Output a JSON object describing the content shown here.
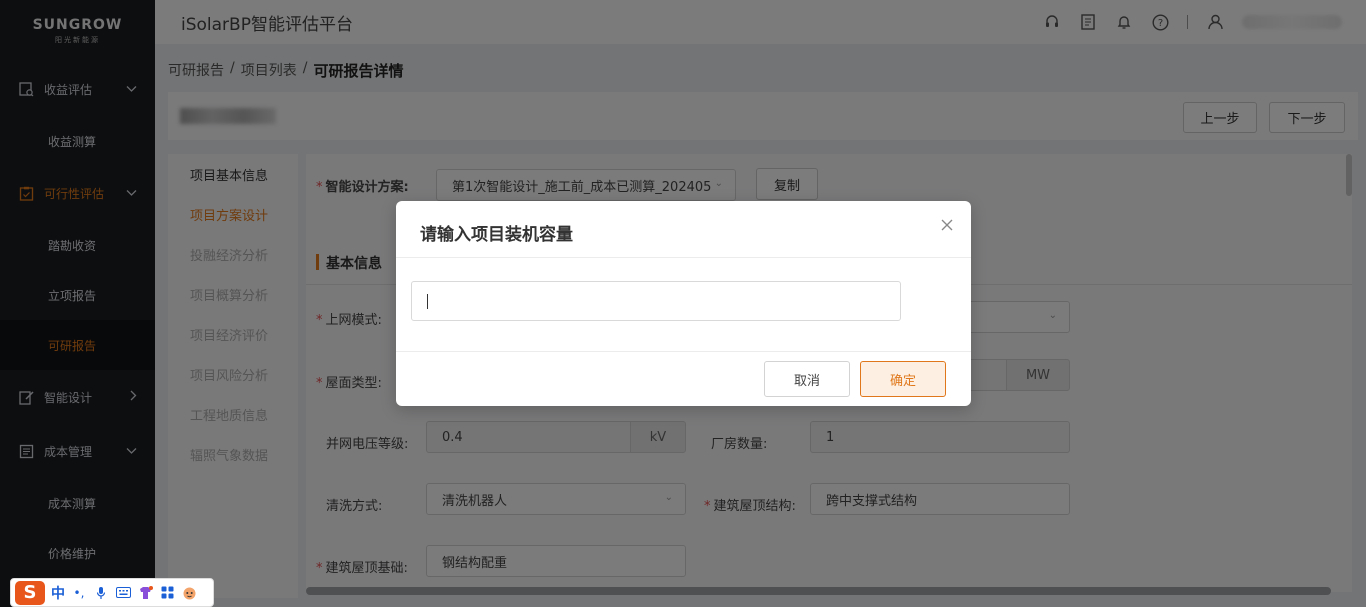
{
  "sidebar": {
    "logo": {
      "brand": "SUNGROW",
      "sub": "阳光新能源"
    },
    "groups": [
      {
        "label": "收益评估",
        "icon": "chart-search-icon",
        "items": [
          "收益测算"
        ]
      },
      {
        "label": "可行性评估",
        "icon": "clipboard-icon",
        "items": [
          "踏勘收资",
          "立项报告",
          "可研报告"
        ]
      },
      {
        "label": "智能设计",
        "icon": "edit-icon"
      },
      {
        "label": "成本管理",
        "icon": "ledger-icon",
        "items": [
          "成本测算",
          "价格维护"
        ]
      }
    ],
    "active_item": "可研报告"
  },
  "header": {
    "title": "iSolarBP智能评估平台"
  },
  "breadcrumb": {
    "items": [
      "可研报告",
      "项目列表"
    ],
    "current": "可研报告详情",
    "sep": "/"
  },
  "toolbar": {
    "prev_label": "上一步",
    "next_label": "下一步"
  },
  "left_nav": {
    "items": [
      {
        "label": "项目基本信息",
        "state": "done"
      },
      {
        "label": "项目方案设计",
        "state": "active"
      },
      {
        "label": "投融经济分析",
        "state": "disabled"
      },
      {
        "label": "项目概算分析",
        "state": "disabled"
      },
      {
        "label": "项目经济评价",
        "state": "disabled"
      },
      {
        "label": "项目风险分析",
        "state": "disabled"
      },
      {
        "label": "工程地质信息",
        "state": "disabled"
      },
      {
        "label": "辐照气象数据",
        "state": "disabled"
      }
    ]
  },
  "form": {
    "scheme_label": "智能设计方案:",
    "scheme_value": "第1次智能设计_施工前_成本已测算_202405",
    "copy_label": "复制",
    "section_title": "基本信息",
    "grid_mode_label": "上网模式:",
    "roof_type_label": "屋面类型:",
    "capacity_unit": "MW",
    "voltage_label": "并网电压等级:",
    "voltage_value": "0.4",
    "voltage_unit": "kV",
    "plant_count_label": "厂房数量:",
    "plant_count_value": "1",
    "cleaning_label": "清洗方式:",
    "cleaning_value": "清洗机器人",
    "roof_structure_label": "建筑屋顶结构:",
    "roof_structure_value": "跨中支撑式结构",
    "roof_base_label": "建筑屋顶基础:",
    "roof_base_value": "钢结构配重"
  },
  "modal": {
    "title": "请输入项目装机容量",
    "input_value": "",
    "cancel_label": "取消",
    "ok_label": "确定"
  },
  "ime": {
    "logo": "S",
    "mode": "中"
  },
  "colors": {
    "accent": "#e0781b",
    "sidebar_bg": "#1b1d20",
    "required": "#e04b4b"
  }
}
